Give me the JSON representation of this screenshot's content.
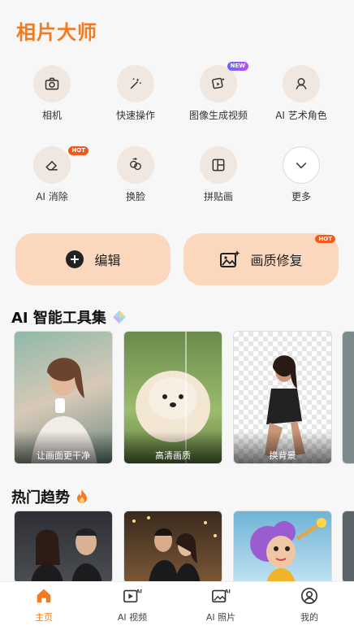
{
  "app": {
    "title": "相片大师"
  },
  "tools": [
    {
      "label": "相机",
      "icon": "camera-icon"
    },
    {
      "label": "快速操作",
      "icon": "magic-wand-icon"
    },
    {
      "label": "图像生成视频",
      "icon": "image-to-video-icon",
      "badge": "NEW"
    },
    {
      "label": "AI 艺术角色",
      "icon": "ai-art-character-icon"
    },
    {
      "label": "AI 消除",
      "icon": "eraser-icon",
      "badge": "HOT"
    },
    {
      "label": "换脸",
      "icon": "face-swap-icon"
    },
    {
      "label": "拼贴画",
      "icon": "collage-icon"
    },
    {
      "label": "更多",
      "icon": "chevron-down-icon"
    }
  ],
  "actions": {
    "edit_label": "编辑",
    "quality_label": "画质修复",
    "quality_badge": "HOT"
  },
  "ai_tools_section": {
    "title": "AI 智能工具集",
    "cards": [
      {
        "caption": "让画面更干净"
      },
      {
        "caption": "高清画质"
      },
      {
        "caption": "换背景"
      }
    ]
  },
  "trending_section": {
    "title": "热门趋势"
  },
  "bottom_nav": [
    {
      "label": "主页",
      "icon": "home-icon",
      "active": true
    },
    {
      "label": "AI 视频",
      "icon": "ai-video-icon"
    },
    {
      "label": "AI 照片",
      "icon": "ai-photo-icon"
    },
    {
      "label": "我的",
      "icon": "profile-icon"
    }
  ],
  "colors": {
    "accent": "#f47a20",
    "button_bg": "#fad7bd",
    "hot": "#f25a1d"
  }
}
